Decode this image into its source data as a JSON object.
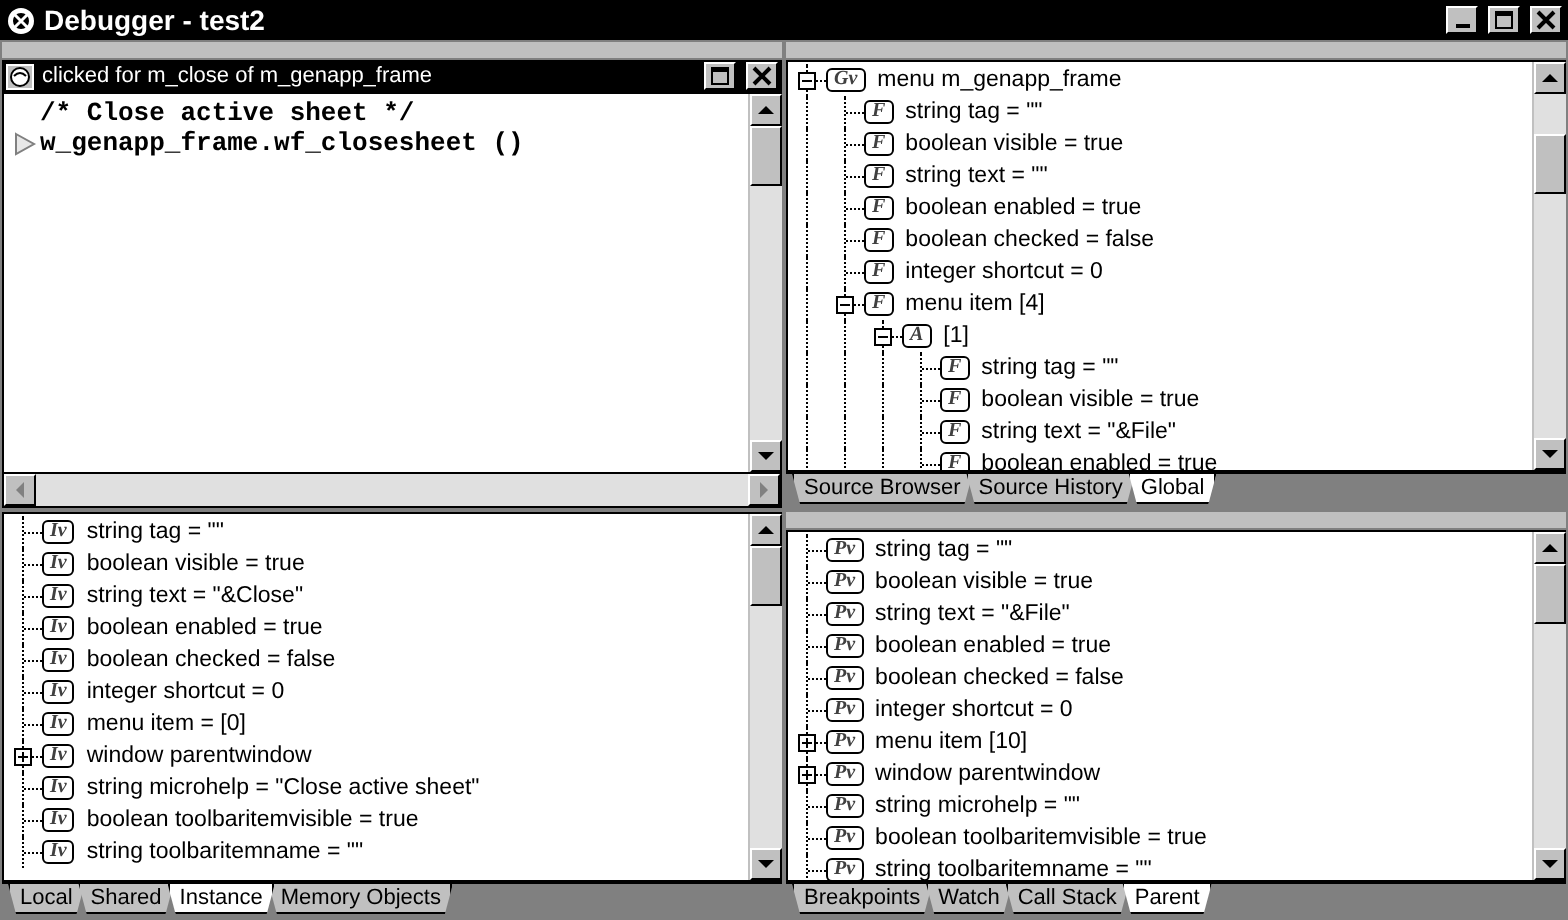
{
  "window": {
    "title": "Debugger - test2"
  },
  "source": {
    "title": "clicked for m_close of m_genapp_frame",
    "lines": [
      {
        "text": "/* Close active sheet */",
        "current": false
      },
      {
        "text": "w_genapp_frame.wf_closesheet ()",
        "current": true
      }
    ]
  },
  "global_pane": {
    "tree": [
      {
        "badge": "Gv",
        "label": "menu m_genapp_frame",
        "expanded": true,
        "children": [
          {
            "badge": "F",
            "label": "string tag = \"\""
          },
          {
            "badge": "F",
            "label": "boolean visible = true"
          },
          {
            "badge": "F",
            "label": "string text = \"\""
          },
          {
            "badge": "F",
            "label": "boolean enabled = true"
          },
          {
            "badge": "F",
            "label": "boolean checked = false"
          },
          {
            "badge": "F",
            "label": "integer shortcut = 0"
          },
          {
            "badge": "F",
            "label": "menu item [4]",
            "expanded": true,
            "children": [
              {
                "badge": "A",
                "label": "[1]",
                "expanded": true,
                "children": [
                  {
                    "badge": "F",
                    "label": "string tag = \"\""
                  },
                  {
                    "badge": "F",
                    "label": "boolean visible = true"
                  },
                  {
                    "badge": "F",
                    "label": "string text = \"&File\""
                  },
                  {
                    "badge": "F",
                    "label": "boolean enabled = true"
                  }
                ]
              }
            ]
          }
        ]
      }
    ],
    "tabs": [
      {
        "label": "Source Browser",
        "selected": false
      },
      {
        "label": "Source History",
        "selected": false
      },
      {
        "label": "Global",
        "selected": true
      }
    ]
  },
  "instance_pane": {
    "tree": [
      {
        "badge": "Iv",
        "label": "string tag = \"\""
      },
      {
        "badge": "Iv",
        "label": "boolean visible = true"
      },
      {
        "badge": "Iv",
        "label": "string text = \"&Close\""
      },
      {
        "badge": "Iv",
        "label": "boolean enabled = true"
      },
      {
        "badge": "Iv",
        "label": "boolean checked = false"
      },
      {
        "badge": "Iv",
        "label": "integer shortcut = 0"
      },
      {
        "badge": "Iv",
        "label": "menu item =  [0]"
      },
      {
        "badge": "Iv",
        "label": "window parentwindow",
        "expanded": false
      },
      {
        "badge": "Iv",
        "label": "string microhelp = \"Close active sheet\""
      },
      {
        "badge": "Iv",
        "label": "boolean toolbaritemvisible = true"
      },
      {
        "badge": "Iv",
        "label": "string toolbaritemname = \"\""
      }
    ],
    "tabs": [
      {
        "label": "Local",
        "selected": false
      },
      {
        "label": "Shared",
        "selected": false
      },
      {
        "label": "Instance",
        "selected": true
      },
      {
        "label": "Memory Objects",
        "selected": false
      }
    ]
  },
  "parent_pane": {
    "tree": [
      {
        "badge": "Pv",
        "label": "string tag = \"\""
      },
      {
        "badge": "Pv",
        "label": "boolean visible = true"
      },
      {
        "badge": "Pv",
        "label": "string text = \"&File\""
      },
      {
        "badge": "Pv",
        "label": "boolean enabled = true"
      },
      {
        "badge": "Pv",
        "label": "boolean checked = false"
      },
      {
        "badge": "Pv",
        "label": "integer shortcut = 0"
      },
      {
        "badge": "Pv",
        "label": "menu item [10]",
        "expanded": false
      },
      {
        "badge": "Pv",
        "label": "window parentwindow",
        "expanded": false
      },
      {
        "badge": "Pv",
        "label": "string microhelp = \"\""
      },
      {
        "badge": "Pv",
        "label": "boolean toolbaritemvisible = true"
      },
      {
        "badge": "Pv",
        "label": "string toolbaritemname = \"\""
      }
    ],
    "tabs": [
      {
        "label": "Breakpoints",
        "selected": false
      },
      {
        "label": "Watch",
        "selected": false
      },
      {
        "label": "Call Stack",
        "selected": false
      },
      {
        "label": "Parent",
        "selected": true
      }
    ]
  }
}
